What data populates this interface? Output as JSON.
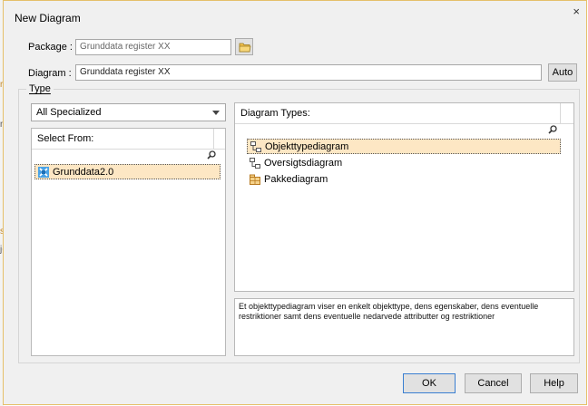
{
  "window": {
    "title": "New Diagram",
    "close_glyph": "×"
  },
  "form": {
    "package_label": "Package :",
    "package_value": "Grunddata register XX",
    "diagram_label": "Diagram :",
    "diagram_value": "Grunddata register XX",
    "auto_label": "Auto"
  },
  "type_group": {
    "label": "Type",
    "filter_value": "All Specialized",
    "select_from_header": "Select From:",
    "select_from_items": [
      "Grunddata2.0"
    ],
    "diagram_types_header": "Diagram Types:",
    "diagram_types": [
      {
        "label": "Objekttypediagram",
        "icon": "class-diagram-icon",
        "selected": true
      },
      {
        "label": "Oversigtsdiagram",
        "icon": "class-diagram-icon",
        "selected": false
      },
      {
        "label": "Pakkediagram",
        "icon": "package-diagram-icon",
        "selected": false
      }
    ],
    "description": "Et objekttypediagram viser en enkelt objekttype, dens egenskaber, dens eventuelle restriktioner samt dens eventuelle nedarvede attributter og restriktioner"
  },
  "buttons": {
    "ok": "OK",
    "cancel": "Cancel",
    "help": "Help"
  },
  "background_marks": [
    "r",
    "n",
    "s",
    "j("
  ],
  "colors": {
    "selection": "#fde7c4",
    "dialog_border": "#e5c06a",
    "default_button_border": "#3a7fd1"
  }
}
